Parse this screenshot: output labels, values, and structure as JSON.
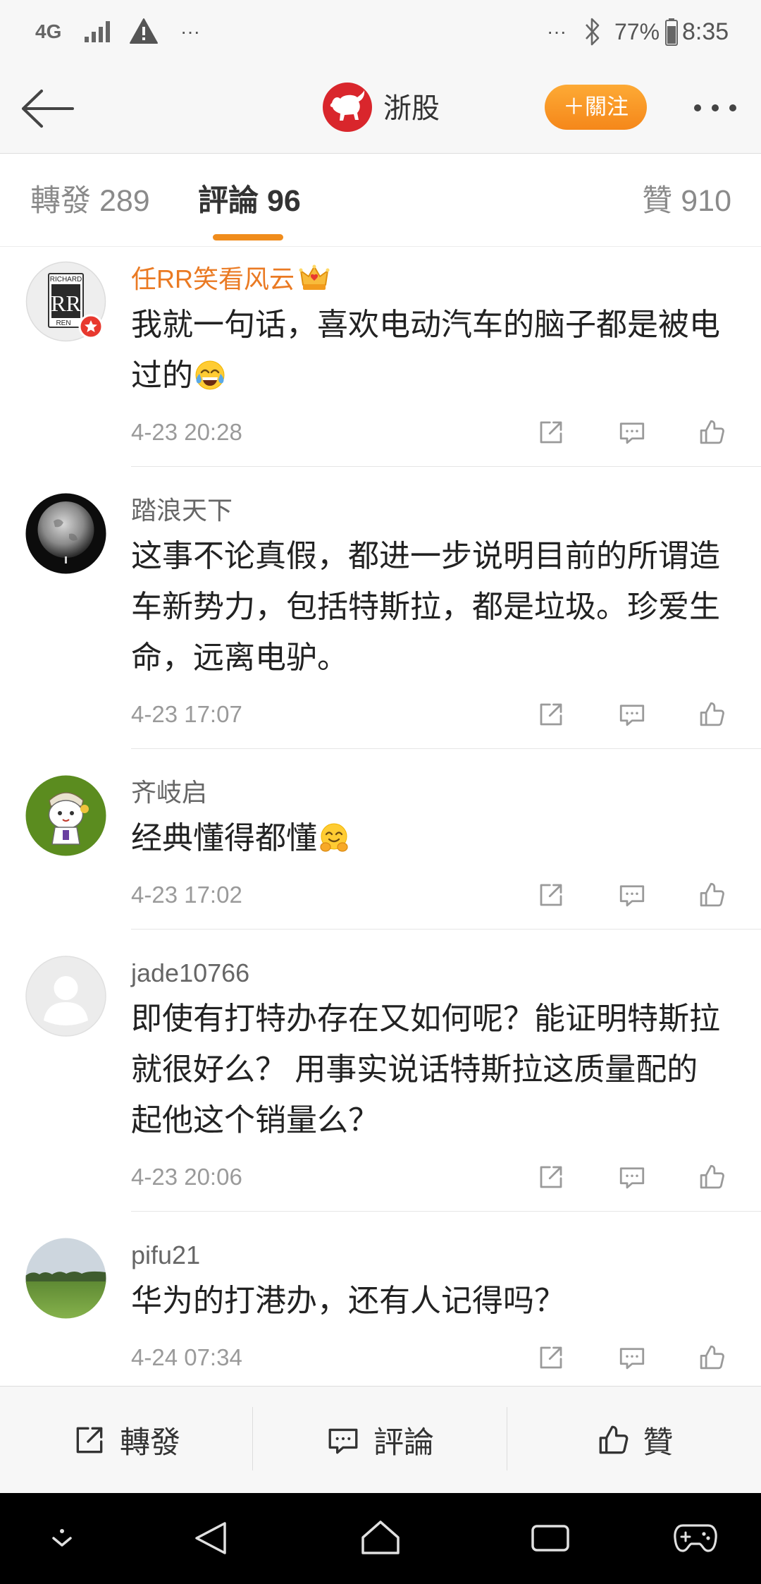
{
  "status_bar": {
    "network": "4G",
    "left_more": "···",
    "right_more": "···",
    "battery": "77%",
    "time": "8:35",
    "icons": [
      "signal-icon",
      "warning-icon",
      "bluetooth-icon",
      "battery-icon"
    ]
  },
  "header": {
    "title": "浙股",
    "follow_label": "＋關注",
    "icons": [
      "back-arrow-icon",
      "bull-logo-icon",
      "more-dots-icon"
    ]
  },
  "tabs": [
    {
      "label": "轉發",
      "count": "289",
      "active": false
    },
    {
      "label": "評論",
      "count": "96",
      "active": true
    },
    {
      "label": "贊",
      "count": "910",
      "active": false
    }
  ],
  "comments": [
    {
      "name": "任RR笑看风云",
      "badge": "crown-icon",
      "avatar": "rolls-royce-badge-avatar",
      "avatar_lettering": {
        "top": "RICHARD",
        "center": "RR",
        "bottom": "REN"
      },
      "lines": [
        "我就一句话，喜欢电动汽车的脑子都是被电",
        "过的"
      ],
      "emoji": "face-with-tears-of-joy-icon",
      "date": "4-23 20:28"
    },
    {
      "name": "踏浪天下",
      "avatar": "earth-night-avatar",
      "lines": [
        "这事不论真假，都进一步说明目前的所谓造",
        "车新势力，包括特斯拉，都是垃圾。珍爱生",
        "命，远离电驴。"
      ],
      "date": "4-23 17:07"
    },
    {
      "name": "齐岐启",
      "avatar": "cartoon-character-avatar",
      "lines": [
        "经典懂得都懂"
      ],
      "emoji": "hugging-face-icon",
      "date": "4-23 17:02"
    },
    {
      "name": "jade10766",
      "avatar": "default-user-avatar",
      "lines": [
        "即使有打特办存在又如何呢？能证明特斯拉",
        "就很好么？ 用事实说话特斯拉这质量配的",
        "起他这个销量么？"
      ],
      "date": "4-23 20:06"
    },
    {
      "name": "pifu21",
      "avatar": "green-field-landscape-avatar",
      "lines": [
        "华为的打港办，还有人记得吗？"
      ],
      "date": "4-24 07:34"
    }
  ],
  "bottom_bar": {
    "repost_label": "轉發",
    "comment_label": "評論",
    "like_label": "贊"
  },
  "colors": {
    "accent": "#f08c1c",
    "follow_button": "#f7911f",
    "vip_name": "#ea7a23",
    "text": "#222222",
    "secondary_text": "#9a9a9a",
    "header_background": "#f7f7f7",
    "nav_background": "#000000"
  }
}
